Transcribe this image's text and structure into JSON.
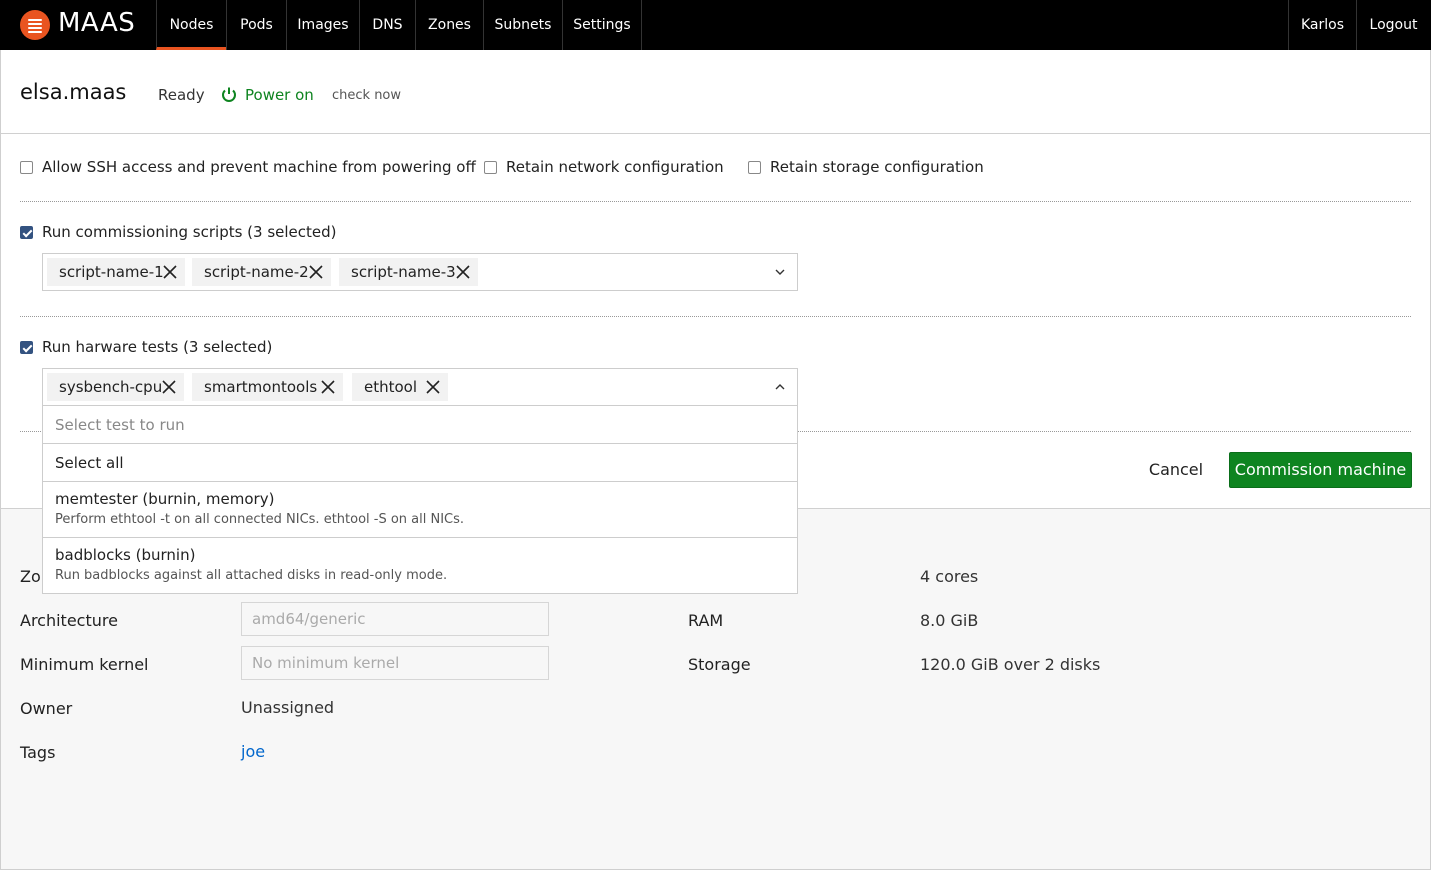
{
  "app": {
    "brand": "MAAS"
  },
  "nav": {
    "items": [
      {
        "label": "Nodes",
        "active": true
      },
      {
        "label": "Pods"
      },
      {
        "label": "Images"
      },
      {
        "label": "DNS"
      },
      {
        "label": "Zones"
      },
      {
        "label": "Subnets"
      },
      {
        "label": "Settings"
      }
    ],
    "user": "Karlos",
    "logout": "Logout"
  },
  "header": {
    "machine_name": "elsa.maas",
    "status": "Ready",
    "power": "Power on",
    "check_now": "check now"
  },
  "options": {
    "ssh": "Allow SSH access and prevent machine from powering off",
    "retain_network": "Retain network configuration",
    "retain_storage": "Retain storage configuration"
  },
  "commissioning": {
    "label": "Run commissioning scripts (3 selected)",
    "checked": true,
    "chips": [
      "script-name-1",
      "script-name-2",
      "script-name-3"
    ]
  },
  "tests": {
    "label": "Run harware tests (3 selected)",
    "checked": true,
    "chips": [
      "sysbench-cpu",
      "smartmontools",
      "ethtool"
    ],
    "dropdown": {
      "placeholder": "Select test to run",
      "select_all": "Select all",
      "items": [
        {
          "title": "memtester (burnin, memory)",
          "desc": "Perform ethtool -t on all connected NICs. ethtool -S on all NICs."
        },
        {
          "title": "badblocks (burnin)",
          "desc": "Run badblocks against all attached disks in read-only mode."
        }
      ]
    }
  },
  "actions": {
    "cancel": "Cancel",
    "commission": "Commission machine"
  },
  "details": {
    "zone_label_partial": "Zor",
    "architecture_label": "Architecture",
    "architecture_value": "amd64/generic",
    "min_kernel_label": "Minimum kernel",
    "min_kernel_value": "No minimum kernel",
    "owner_label": "Owner",
    "owner_value": "Unassigned",
    "tags_label": "Tags",
    "tags_value": "joe",
    "cpu_value": "4 cores",
    "ram_label": "RAM",
    "ram_value": "8.0 GiB",
    "storage_label": "Storage",
    "storage_value": "120.0 GiB over 2 disks"
  },
  "colors": {
    "brand_orange": "#e95420",
    "success_green": "#0e8420",
    "checkbox_blue": "#335280",
    "link_blue": "#0066cc"
  }
}
